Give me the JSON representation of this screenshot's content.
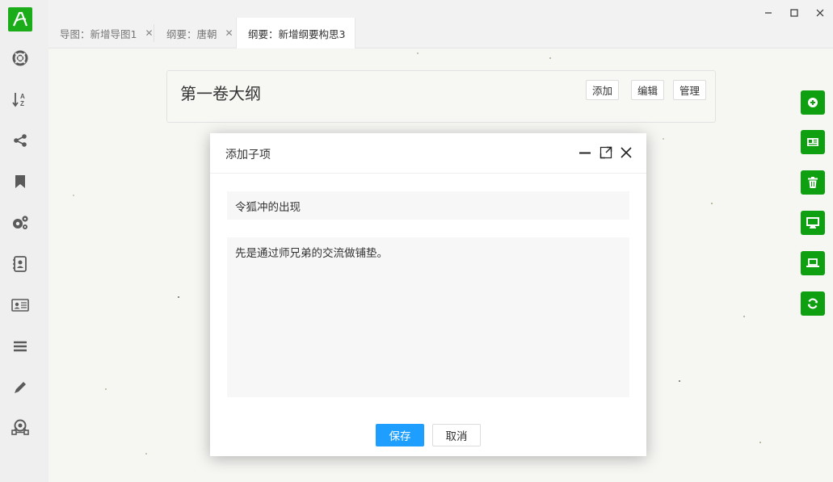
{
  "tabs": [
    {
      "label": "导图：新增导图1",
      "active": false
    },
    {
      "label": "纲要：唐朝",
      "active": false
    },
    {
      "label": "纲要：新增纲要构思3",
      "active": true
    }
  ],
  "window": {
    "minimize": "–",
    "maximize": "□",
    "close": "✕"
  },
  "sidebar": {
    "items": [
      {
        "icon": "lifebuoy-icon"
      },
      {
        "icon": "sort-az-icon"
      },
      {
        "icon": "share-icon"
      },
      {
        "icon": "bookmark-icon"
      },
      {
        "icon": "gears-icon"
      },
      {
        "icon": "contact-book-icon"
      },
      {
        "icon": "id-card-icon"
      },
      {
        "icon": "menu-icon"
      },
      {
        "icon": "pencil-icon"
      },
      {
        "icon": "network-icon"
      }
    ]
  },
  "outline": {
    "title": "第一卷大纲",
    "buttons": {
      "add": "添加",
      "edit": "编辑",
      "manage": "管理"
    }
  },
  "right_toolbar": {
    "items": [
      {
        "icon": "plus-circle-icon"
      },
      {
        "icon": "newspaper-icon"
      },
      {
        "icon": "trash-icon"
      },
      {
        "icon": "desktop-icon"
      },
      {
        "icon": "laptop-icon"
      },
      {
        "icon": "refresh-icon"
      }
    ]
  },
  "dialog": {
    "title": "添加子项",
    "name_value": "令狐冲的出现",
    "description_value": "先是通过师兄弟的交流做铺垫。",
    "save_label": "保存",
    "cancel_label": "取消"
  },
  "colors": {
    "brand_green": "#1aad19",
    "fab_green": "#0ea010",
    "primary_blue": "#1e9fff"
  }
}
